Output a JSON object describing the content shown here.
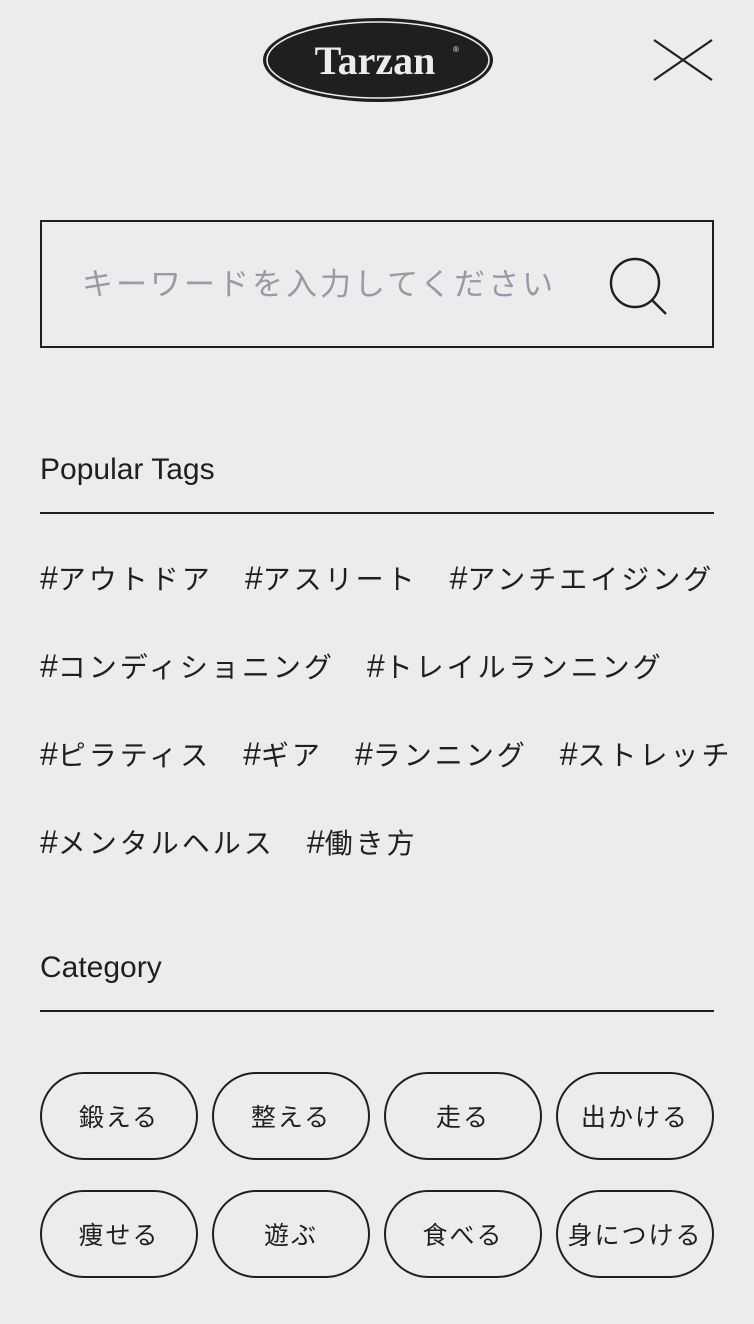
{
  "brand": {
    "logo_text": "Tarzan",
    "registered_mark": "®"
  },
  "header": {
    "close_icon": "close-icon"
  },
  "search": {
    "placeholder": "キーワードを入力してください",
    "value": "",
    "icon": "search-icon"
  },
  "popular_tags": {
    "heading": "Popular Tags",
    "rows": [
      [
        "アウトドア",
        "アスリート",
        "アンチエイジング"
      ],
      [
        "コンディショニング",
        "トレイルランニング"
      ],
      [
        "ピラティス",
        "ギア",
        "ランニング",
        "ストレッチ"
      ],
      [
        "メンタルヘルス",
        "働き方"
      ]
    ],
    "hash": "#"
  },
  "category": {
    "heading": "Category",
    "rows": [
      [
        "鍛える",
        "整える",
        "走る",
        "出かける"
      ],
      [
        "痩せる",
        "遊ぶ",
        "食べる",
        "身につける"
      ]
    ]
  },
  "colors": {
    "background": "#ececec",
    "text": "#1f1f1f",
    "placeholder": "#9a9aa4",
    "logo_fill": "#1f1f1f"
  }
}
